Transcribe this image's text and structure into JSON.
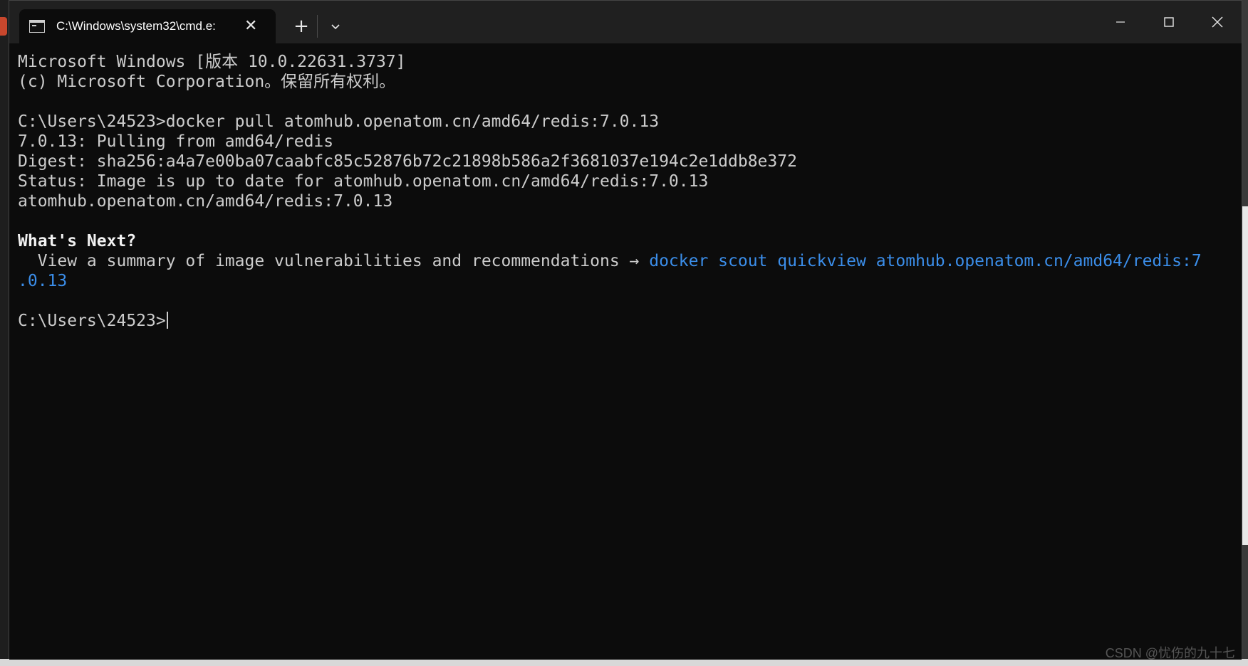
{
  "window": {
    "tab_title": "C:\\Windows\\system32\\cmd.e:",
    "icons": {
      "tab": "terminal-icon",
      "tab_close": "close-icon",
      "new_tab": "plus-icon",
      "dropdown": "chevron-down-icon",
      "minimize": "minimize-icon",
      "maximize": "maximize-icon",
      "close": "close-icon"
    }
  },
  "terminal": {
    "lines": [
      "Microsoft Windows [版本 10.0.22631.3737]",
      "(c) Microsoft Corporation。保留所有权利。",
      "",
      "C:\\Users\\24523>docker pull atomhub.openatom.cn/amd64/redis:7.0.13",
      "7.0.13: Pulling from amd64/redis",
      "Digest: sha256:a4a7e00ba07caabfc85c52876b72c21898b586a2f3681037e194c2e1ddb8e372",
      "Status: Image is up to date for atomhub.openatom.cn/amd64/redis:7.0.13",
      "atomhub.openatom.cn/amd64/redis:7.0.13",
      ""
    ],
    "whats_next": "What's Next?",
    "recommendation_text": "  View a summary of image vulnerabilities and recommendations → ",
    "recommendation_command_line1": "docker scout quickview atomhub.openatom.cn/amd64/redis:7",
    "recommendation_command_line2": ".0.13",
    "prompt": "C:\\Users\\24523>"
  },
  "colors": {
    "background": "#0c0c0c",
    "text": "#cccccc",
    "link": "#3b8eea"
  },
  "watermark": "CSDN @忧伤的九十七"
}
